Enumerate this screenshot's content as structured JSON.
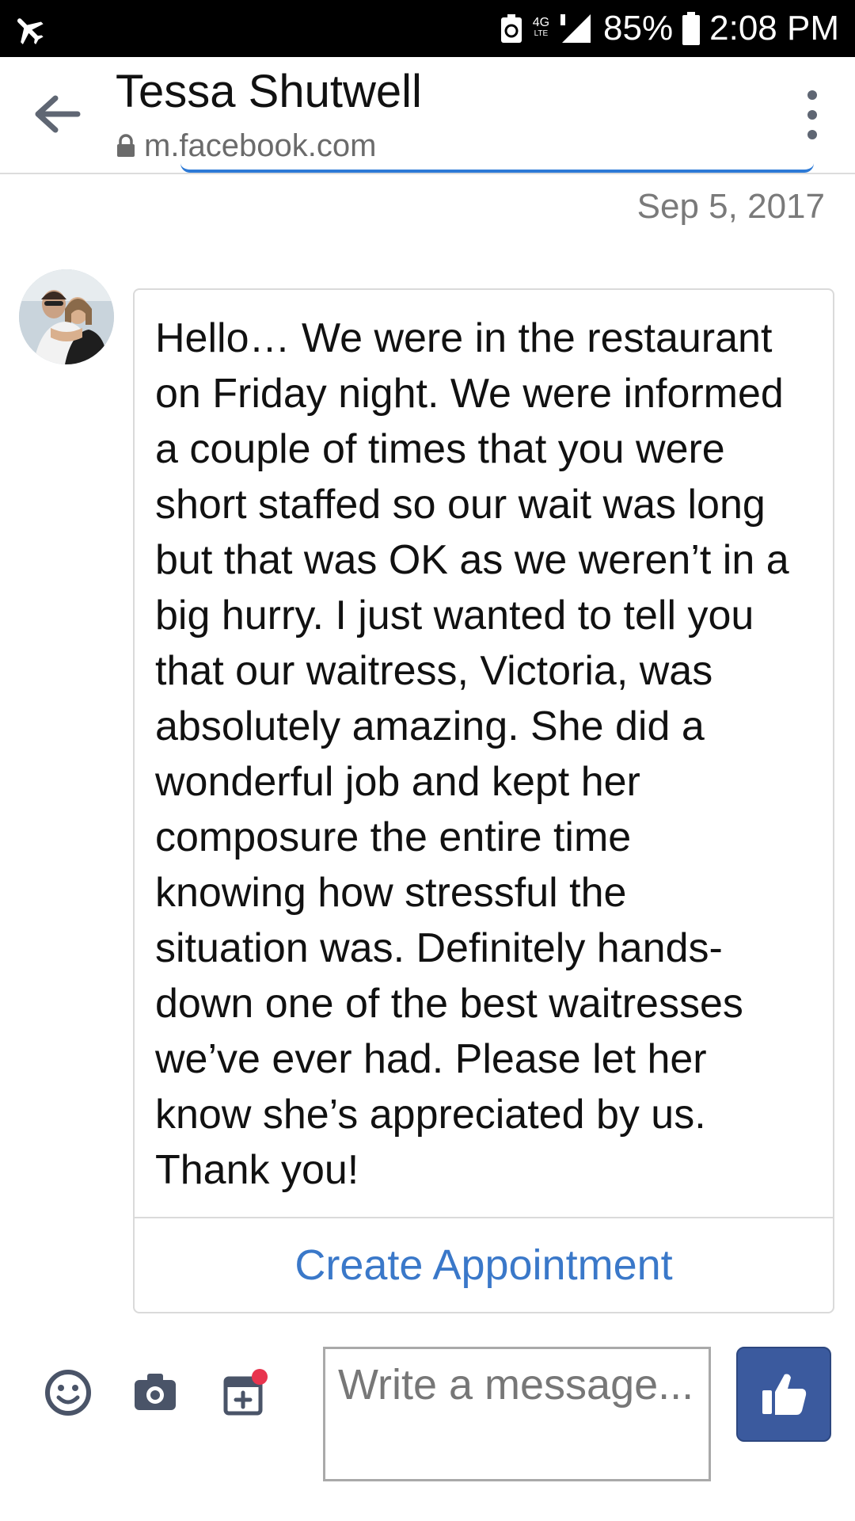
{
  "status_bar": {
    "network": "4G",
    "network_sub": "LTE",
    "battery": "85%",
    "time": "2:08 PM",
    "icons": [
      "airplane-mode-icon",
      "data-saver-icon",
      "signal-icon",
      "battery-icon"
    ]
  },
  "header": {
    "title": "Tessa Shutwell",
    "url": "m.facebook.com",
    "icons": [
      "back-arrow-icon",
      "lock-icon",
      "more-vertical-icon"
    ]
  },
  "conversation": {
    "date": "Sep 5, 2017",
    "message": "Hello… We were in the restaurant\non Friday night. We were informed\na couple of times that you were\nshort staffed so our wait was long\nbut that was OK as we weren’t in a\nbig hurry. I just wanted to tell you\nthat our waitress, Victoria, was\nabsolutely amazing. She did a\nwonderful job and kept her\ncomposure the entire time\nknowing how stressful the\nsituation was. Definitely hands-\ndown one of the best waitresses\nwe’ve ever had. Please let her\nknow she’s appreciated by us.\nThank you!",
    "action_label": "Create Appointment"
  },
  "composer": {
    "placeholder": "Write a message...",
    "value": "",
    "icons": [
      "emoji-icon",
      "camera-icon",
      "schedule-icon",
      "thumbs-up-icon"
    ]
  },
  "colors": {
    "accent_blue": "#3a78c9",
    "like_button": "#3b5a9e",
    "notification_dot": "#e8344e",
    "status_bar_bg": "#000000"
  }
}
